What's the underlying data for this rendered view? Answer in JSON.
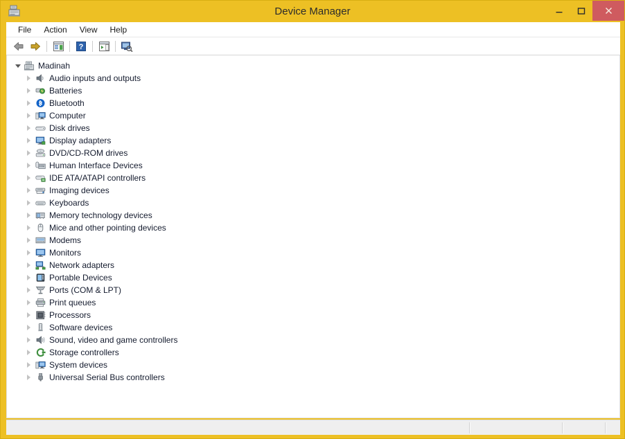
{
  "window": {
    "title": "Device Manager",
    "app_icon": "device-manager-icon",
    "frame_color": "#edc024",
    "close_button_color": "#cf5b5f",
    "buttons": {
      "minimize": "–",
      "maximize": "❒",
      "close": "✕"
    }
  },
  "menubar": {
    "items": [
      {
        "label": "File",
        "name": "menu-file"
      },
      {
        "label": "Action",
        "name": "menu-action"
      },
      {
        "label": "View",
        "name": "menu-view"
      },
      {
        "label": "Help",
        "name": "menu-help"
      }
    ]
  },
  "toolbar": {
    "buttons": [
      {
        "name": "back-button",
        "icon": "left-arrow-icon"
      },
      {
        "name": "forward-button",
        "icon": "right-arrow-icon"
      },
      {
        "name": "show-hide-console-tree-button",
        "icon": "console-tree-icon"
      },
      {
        "name": "help-button",
        "icon": "question-mark-icon"
      },
      {
        "name": "properties-button",
        "icon": "properties-panel-icon"
      },
      {
        "name": "scan-for-hardware-changes-button",
        "icon": "scan-hardware-icon"
      }
    ]
  },
  "tree": {
    "root": {
      "label": "Madinah",
      "icon": "computer-node-icon",
      "expanded": true
    },
    "items": [
      {
        "label": "Audio inputs and outputs",
        "icon": "speaker-icon"
      },
      {
        "label": "Batteries",
        "icon": "battery-icon"
      },
      {
        "label": "Bluetooth",
        "icon": "bluetooth-icon"
      },
      {
        "label": "Computer",
        "icon": "computer-icon"
      },
      {
        "label": "Disk drives",
        "icon": "disk-drive-icon"
      },
      {
        "label": "Display adapters",
        "icon": "display-adapter-icon"
      },
      {
        "label": "DVD/CD-ROM drives",
        "icon": "dvd-drive-icon"
      },
      {
        "label": "Human Interface Devices",
        "icon": "hid-icon"
      },
      {
        "label": "IDE ATA/ATAPI controllers",
        "icon": "ide-controller-icon"
      },
      {
        "label": "Imaging devices",
        "icon": "imaging-device-icon"
      },
      {
        "label": "Keyboards",
        "icon": "keyboard-icon"
      },
      {
        "label": "Memory technology devices",
        "icon": "memory-device-icon"
      },
      {
        "label": "Mice and other pointing devices",
        "icon": "mouse-icon"
      },
      {
        "label": "Modems",
        "icon": "modem-icon"
      },
      {
        "label": "Monitors",
        "icon": "monitor-icon"
      },
      {
        "label": "Network adapters",
        "icon": "network-adapter-icon"
      },
      {
        "label": "Portable Devices",
        "icon": "portable-device-icon"
      },
      {
        "label": "Ports (COM & LPT)",
        "icon": "port-icon"
      },
      {
        "label": "Print queues",
        "icon": "printer-icon"
      },
      {
        "label": "Processors",
        "icon": "processor-icon"
      },
      {
        "label": "Software devices",
        "icon": "software-device-icon"
      },
      {
        "label": "Sound, video and game controllers",
        "icon": "sound-controller-icon"
      },
      {
        "label": "Storage controllers",
        "icon": "storage-controller-icon"
      },
      {
        "label": "System devices",
        "icon": "system-device-icon"
      },
      {
        "label": "Universal Serial Bus controllers",
        "icon": "usb-controller-icon"
      }
    ]
  },
  "statusbar": {
    "cells": [
      "",
      "",
      ""
    ]
  }
}
